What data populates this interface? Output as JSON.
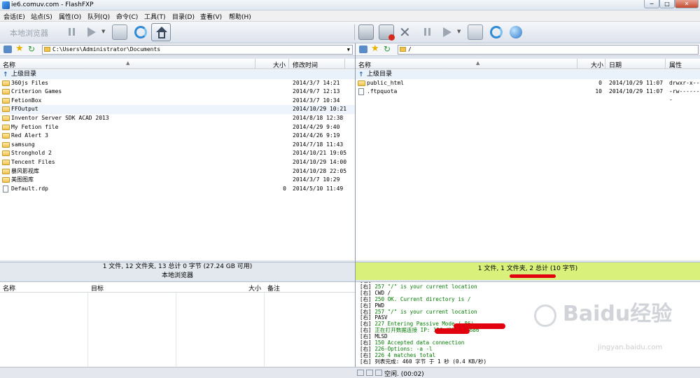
{
  "window": {
    "title": "ie6.comuv.com - FlashFXP"
  },
  "menu": [
    "会话(E)",
    "站点(S)",
    "属性(O)",
    "队列(Q)",
    "命令(C)",
    "工具(T)",
    "目录(D)",
    "查看(V)",
    "帮助(H)"
  ],
  "toolbar": {
    "local_browser_label": "本地浏览器"
  },
  "local": {
    "path": "C:\\Users\\Administrator\\Documents",
    "columns": {
      "name": "名称",
      "size": "大小",
      "modified": "修改时间"
    },
    "up_label": "上级目录",
    "rows": [
      {
        "name": "360js Files",
        "size": "",
        "date": "2014/3/7 14:21",
        "type": "folder"
      },
      {
        "name": "Criterion Games",
        "size": "",
        "date": "2014/9/7 12:13",
        "type": "folder"
      },
      {
        "name": "FetionBox",
        "size": "",
        "date": "2014/3/7 10:34",
        "type": "folder"
      },
      {
        "name": "FFOutput",
        "size": "",
        "date": "2014/10/29 10:21",
        "type": "folder"
      },
      {
        "name": "Inventor Server SDK ACAD 2013",
        "size": "",
        "date": "2014/8/18 12:38",
        "type": "folder"
      },
      {
        "name": "My Fetion file",
        "size": "",
        "date": "2014/4/29 9:40",
        "type": "folder"
      },
      {
        "name": "Red Alert 3",
        "size": "",
        "date": "2014/4/26 9:19",
        "type": "folder"
      },
      {
        "name": "samsung",
        "size": "",
        "date": "2014/7/18 11:43",
        "type": "folder"
      },
      {
        "name": "Stronghold 2",
        "size": "",
        "date": "2014/10/21 19:05",
        "type": "folder"
      },
      {
        "name": "Tencent Files",
        "size": "",
        "date": "2014/10/29 14:00",
        "type": "folder"
      },
      {
        "name": "暴风影视库",
        "size": "",
        "date": "2014/10/28 22:05",
        "type": "folder"
      },
      {
        "name": "美图图库",
        "size": "",
        "date": "2014/3/7 10:29",
        "type": "folder"
      },
      {
        "name": "Default.rdp",
        "size": "0",
        "date": "2014/5/10 11:49",
        "type": "file"
      }
    ],
    "status": "1 文件, 12 文件夹, 13 总计 0 字节 (27.24 GB 可用)",
    "panel_label": "本地浏览器"
  },
  "remote": {
    "path": "/",
    "columns": {
      "name": "名称",
      "size": "大小",
      "date": "日期",
      "attr": "属性"
    },
    "up_label": "上级目录",
    "rows": [
      {
        "name": "public_html",
        "size": "0",
        "date": "2014/10/29 11:07",
        "attr": "drwxr-x---",
        "type": "folder"
      },
      {
        "name": ".ftpquota",
        "size": "10",
        "date": "2014/10/29 11:07",
        "attr": "-rw-------",
        "type": "file"
      }
    ],
    "status": "1 文件, 1 文件夹, 2 总计 (10 字节)"
  },
  "queue": {
    "columns": {
      "name": "名称",
      "target": "目标",
      "size": "大小",
      "note": "备注"
    }
  },
  "log": [
    {
      "tag": "[右]",
      "text": "PWD",
      "cls": "b"
    },
    {
      "tag": "[右]",
      "text": "257 \"/\" is your current location",
      "cls": "g"
    },
    {
      "tag": "[右]",
      "text": "CWD /",
      "cls": "b"
    },
    {
      "tag": "[右]",
      "text": "250 OK. Current directory is /",
      "cls": "g"
    },
    {
      "tag": "[右]",
      "text": "PWD",
      "cls": "b"
    },
    {
      "tag": "[右]",
      "text": "257 \"/\" is your current location",
      "cls": "g"
    },
    {
      "tag": "[右]",
      "text": "PASV",
      "cls": "b"
    },
    {
      "tag": "[右]",
      "text": "227 Entering Passive Mode (                 86)",
      "cls": "g"
    },
    {
      "tag": "[右]",
      "text": "正在打开数据连接 IP:            150 端口: 57686",
      "cls": "g"
    },
    {
      "tag": "[右]",
      "text": "MLSD",
      "cls": "b"
    },
    {
      "tag": "[右]",
      "text": "150 Accepted data connection",
      "cls": "g"
    },
    {
      "tag": "[右]",
      "text": "226-Options: -a -l",
      "cls": "g"
    },
    {
      "tag": "[右]",
      "text": "226 4 matches total",
      "cls": "g"
    },
    {
      "tag": "[右]",
      "text": "列表完成: 460 字节 于 1 秒 (0.4 KB/秒)",
      "cls": "b"
    }
  ],
  "statusbar": {
    "idle": "空闲. (00:02)"
  },
  "watermark": {
    "main": "Baidu经验",
    "sub": "jingyan.baidu.com"
  },
  "colors": {
    "remote_status_bg": "#d9f07a",
    "log_green": "#007a00",
    "redact": "#e0000e"
  }
}
